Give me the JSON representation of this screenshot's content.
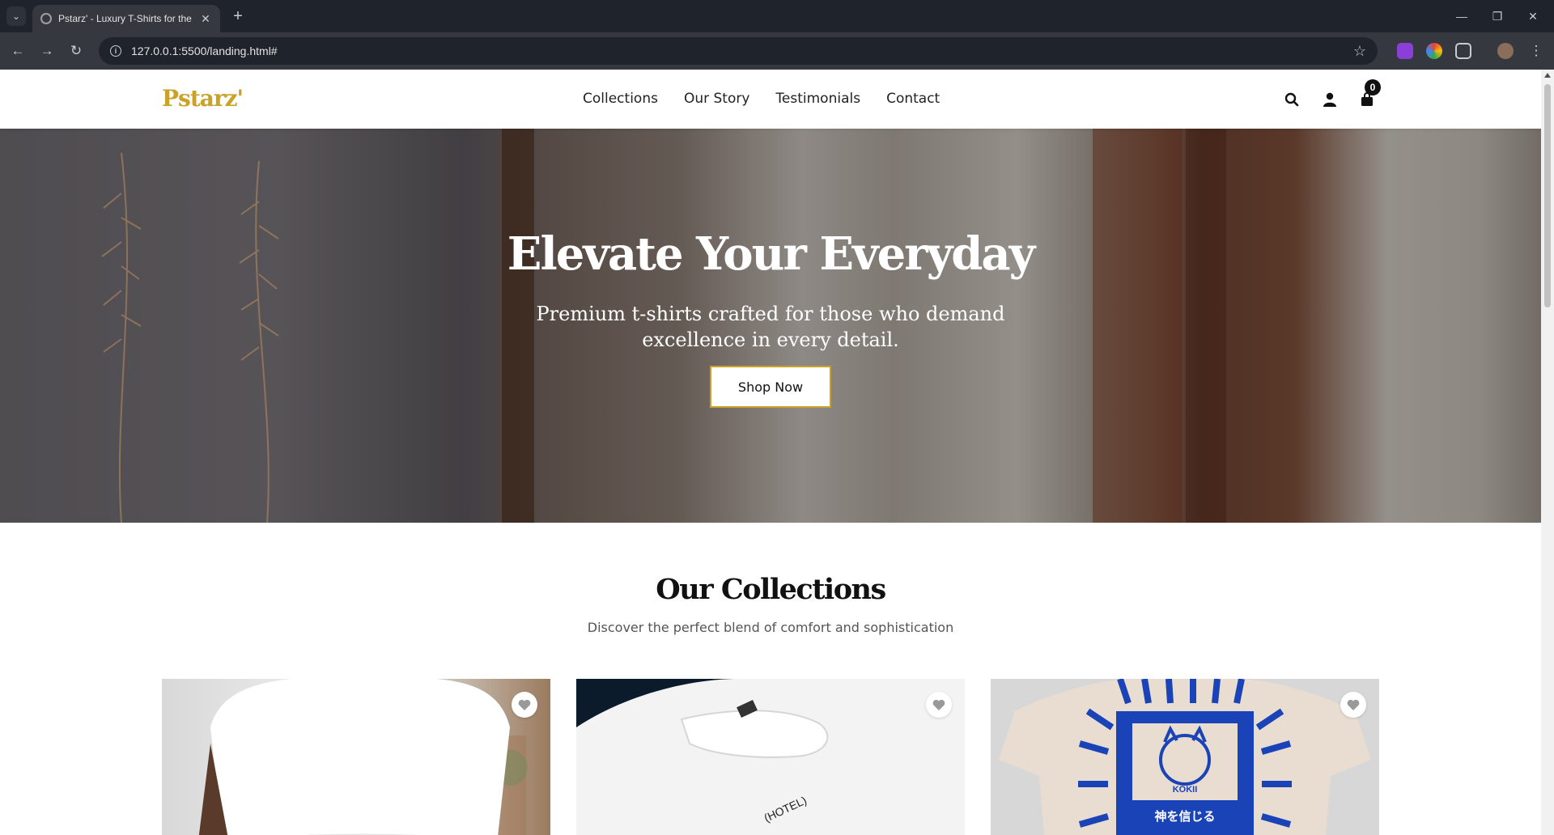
{
  "browser": {
    "tab_title": "Pstarz' - Luxury T-Shirts for the",
    "url": "127.0.0.1:5500/landing.html#"
  },
  "header": {
    "logo": "Pstarz'",
    "nav": [
      "Collections",
      "Our Story",
      "Testimonials",
      "Contact"
    ],
    "cart_count": "0",
    "accent_color": "#c9a227"
  },
  "hero": {
    "title": "Elevate Your Everyday",
    "subtitle": "Premium t-shirts crafted for those who demand excellence in every detail.",
    "cta": "Shop Now"
  },
  "collections": {
    "title": "Our Collections",
    "subtitle": "Discover the perfect blend of comfort and sophistication",
    "cards": [
      {
        "image": "white-tshirt-model",
        "favorite_icon": "heart-icon"
      },
      {
        "image": "white-tshirt-hotel-print",
        "print_text": "(HOTEL)",
        "favorite_icon": "heart-icon"
      },
      {
        "image": "beige-tshirt-lucky-cat-print",
        "print_text": "KOKII",
        "print_subtext": "神を信じる",
        "favorite_icon": "heart-icon"
      }
    ]
  }
}
